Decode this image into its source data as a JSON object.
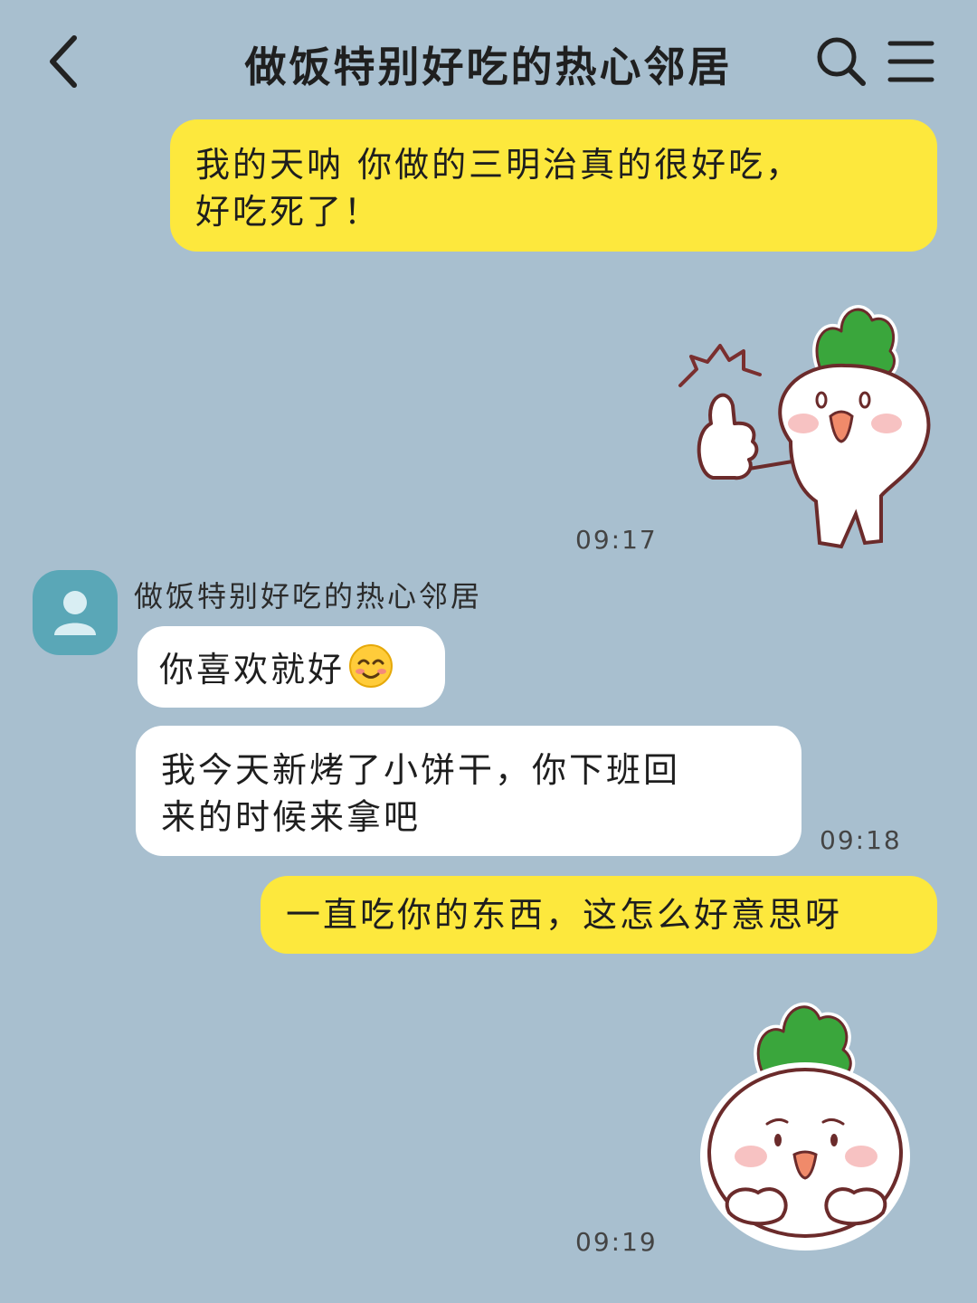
{
  "header": {
    "title": "做饭特别好吃的热心邻居",
    "back_icon": "chevron-left-icon",
    "search_icon": "search-icon",
    "menu_icon": "menu-icon"
  },
  "messages": [
    {
      "side": "me",
      "type": "text",
      "lines": [
        "我的天呐 你做的三明治真的很好吃，",
        "好吃死了！"
      ]
    },
    {
      "side": "me",
      "type": "sticker",
      "sticker": "radish-thumbs-up-sticker"
    },
    {
      "time": "09:17"
    },
    {
      "side": "them",
      "sender": "做饭特别好吃的热心邻居",
      "type": "text",
      "text": "你喜欢就好",
      "emoji": "smiling-face-emoji"
    },
    {
      "side": "them",
      "type": "text",
      "lines": [
        "我今天新烤了小饼干，你下班回",
        "来的时候来拿吧"
      ]
    },
    {
      "time": "09:18"
    },
    {
      "side": "me",
      "type": "text",
      "text": "一直吃你的东西，这怎么好意思呀"
    },
    {
      "side": "me",
      "type": "sticker",
      "sticker": "radish-shy-sticker"
    },
    {
      "time": "09:19"
    }
  ],
  "colors": {
    "background": "#a8bfcf",
    "my_bubble": "#fde83d",
    "their_bubble": "#ffffff",
    "avatar": "#5aa7b7",
    "radish_leaf": "#3aa63c"
  }
}
